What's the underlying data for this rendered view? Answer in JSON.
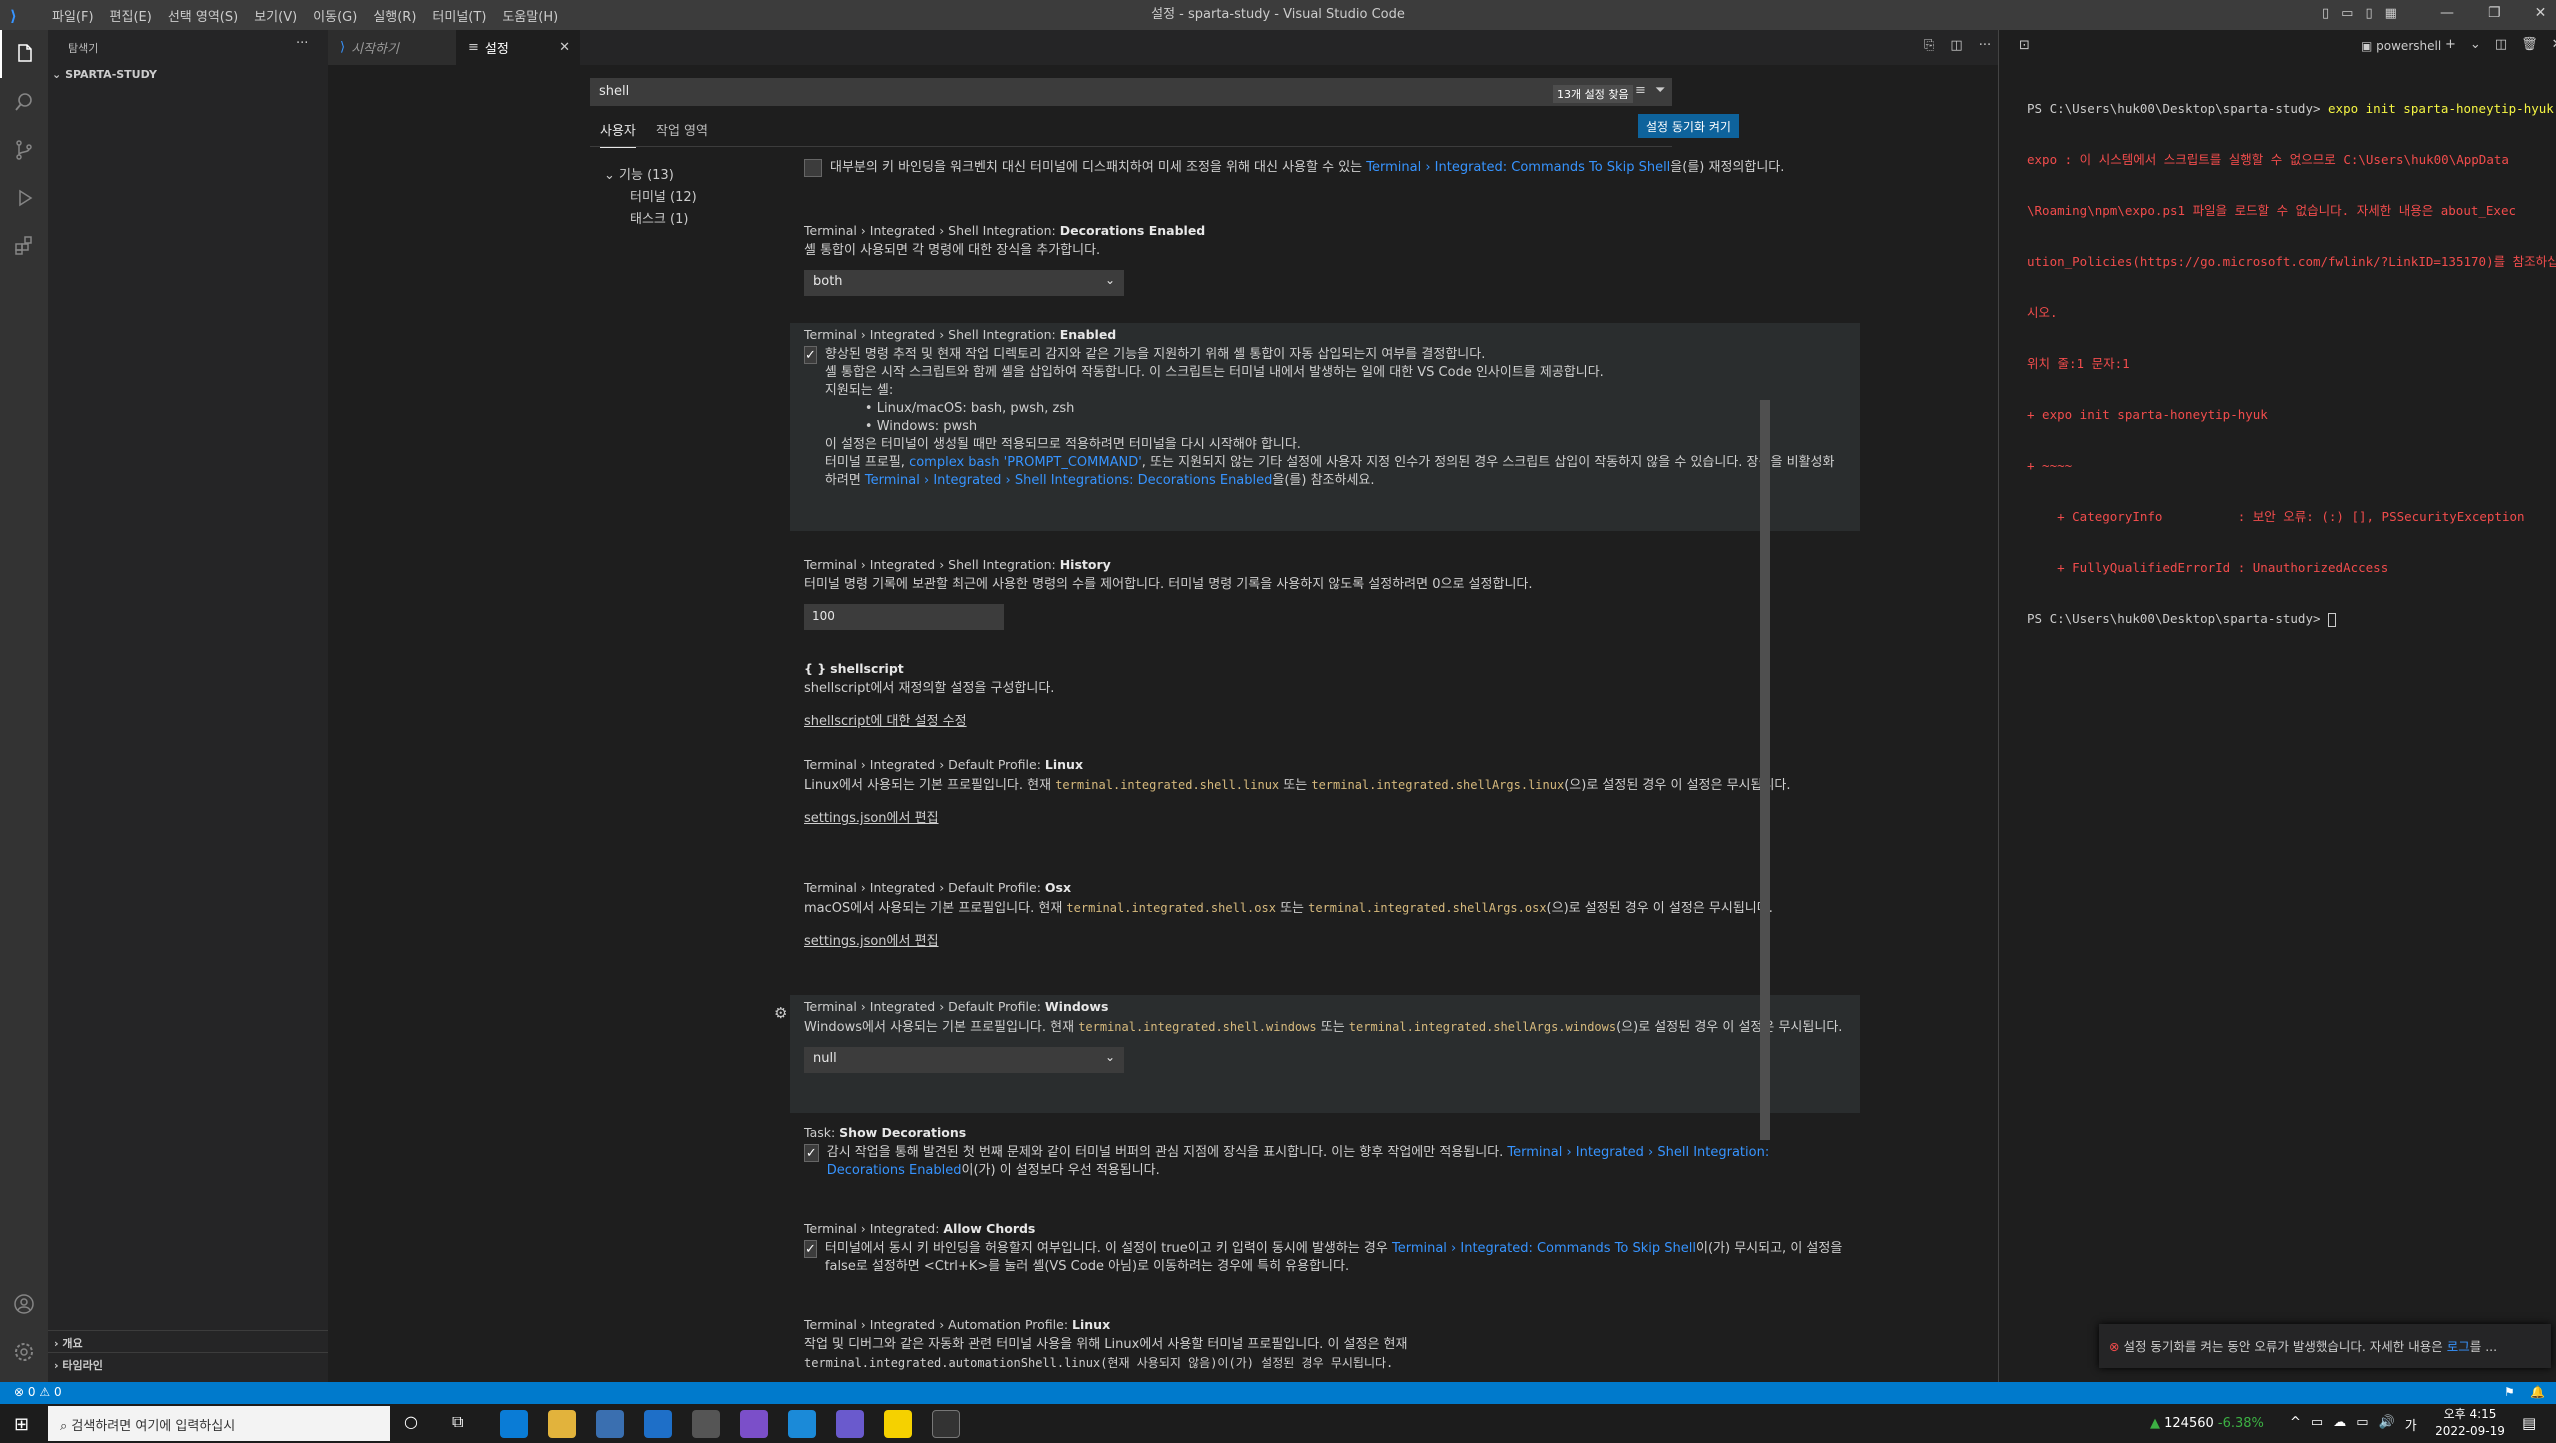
{
  "window": {
    "title": "설정 - sparta-study - Visual Studio Code"
  },
  "menu": [
    "파일(F)",
    "편집(E)",
    "선택 영역(S)",
    "보기(V)",
    "이동(G)",
    "실행(R)",
    "터미널(T)",
    "도움말(H)"
  ],
  "sidebar": {
    "title": "탐색기",
    "folder": "SPARTA-STUDY",
    "outline": "개요",
    "timeline": "타임라인"
  },
  "tabs": [
    {
      "label": "시작하기"
    },
    {
      "label": "설정"
    }
  ],
  "settings": {
    "search_value": "shell",
    "result_count": "13개 설정 찾음",
    "scope_user": "사용자",
    "scope_workspace": "작업 영역",
    "sync_button": "설정 동기화 켜기",
    "toc": {
      "group": "기능 (13)",
      "terminal": "터미널 (12)",
      "task": "태스크 (1)"
    },
    "items": {
      "skip_desc": "대부분의 키 바인딩을 워크벤치 대신 터미널에 디스패치하여 미세 조정을 위해 대신 사용할 수 있는 ",
      "skip_link": "Terminal › Integrated: Commands To Skip Shell",
      "skip_tail": "을(를) 재정의합니다.",
      "deco_cat": "Terminal › Integrated › Shell Integration: ",
      "deco_name": "Decorations Enabled",
      "deco_desc": "셸 통합이 사용되면 각 명령에 대한 장식을 추가합니다.",
      "deco_value": "both",
      "en_cat": "Terminal › Integrated › Shell Integration: ",
      "en_name": "Enabled",
      "en_l1": "향상된 명령 추적 및 현재 작업 디렉토리 감지와 같은 기능을 지원하기 위해 셸 통합이 자동 삽입되는지 여부를 결정합니다.",
      "en_l2": "셸 통합은 시작 스크립트와 함께 셸을 삽입하여 작동합니다. 이 스크립트는 터미널 내에서 발생하는 일에 대한 VS Code 인사이트를 제공합니다.",
      "en_l3": "지원되는 셸:",
      "en_b1": "Linux/macOS: bash, pwsh, zsh",
      "en_b2": "Windows: pwsh",
      "en_l4": "이 설정은 터미널이 생성될 때만 적용되므로 적용하려면 터미널을 다시 시작해야 합니다.",
      "en_l5a": "터미널 프로필, ",
      "en_l5link": "complex bash 'PROMPT_COMMAND'",
      "en_l5b": ", 또는 지원되지 않는 기타 설정에 사용자 지정 인수가 정의된 경우 스크립트 삽입이 작동하지 않을 수 있습니다. 장식을 비활성화하려면 ",
      "en_l5link2": "Terminal › Integrated › Shell Integrations: Decorations Enabled",
      "en_l5c": "을(를) 참조하세요.",
      "hist_cat": "Terminal › Integrated › Shell Integration: ",
      "hist_name": "History",
      "hist_desc": "터미널 명령 기록에 보관할 최근에 사용한 명령의 수를 제어합니다. 터미널 명령 기록을 사용하지 않도록 설정하려면 0으로 설정합니다.",
      "hist_value": "100",
      "ss_braces": "{ }",
      "ss_name": "shellscript",
      "ss_desc": "shellscript에서 재정의할 설정을 구성합니다.",
      "ss_link": "shellscript에 대한 설정 수정",
      "lin_cat": "Terminal › Integrated › Default Profile: ",
      "lin_name": "Linux",
      "lin_a": "Linux에서 사용되는 기본 프로필입니다. 현재 ",
      "lin_c1": "terminal.integrated.shell.linux",
      "lin_b": " 또는 ",
      "lin_c2": "terminal.integrated.shellArgs.linux",
      "lin_d": "(으)로 설정된 경우 이 설정은 무시됩니다.",
      "json_link": "settings.json에서 편집",
      "osx_cat": "Terminal › Integrated › Default Profile: ",
      "osx_name": "Osx",
      "osx_a": "macOS에서 사용되는 기본 프로필입니다. 현재 ",
      "osx_c1": "terminal.integrated.shell.osx",
      "osx_b": " 또는 ",
      "osx_c2": "terminal.integrated.shellArgs.osx",
      "osx_d": "(으)로 설정된 경우 이 설정은 무시됩니다.",
      "win_cat": "Terminal › Integrated › Default Profile: ",
      "win_name": "Windows",
      "win_a": "Windows에서 사용되는 기본 프로필입니다. 현재 ",
      "win_c1": "terminal.integrated.shell.windows",
      "win_b": " 또는 ",
      "win_c2": "terminal.integrated.shellArgs.windows",
      "win_d": "(으)로 설정된 경우 이 설정은 무시됩니다.",
      "win_value": "null",
      "task_cat": "Task: ",
      "task_name": "Show Decorations",
      "task_a": "감시 작업을 통해 발견된 첫 번째 문제와 같이 터미널 버퍼의 관심 지점에 장식을 표시합니다. 이는 향후 작업에만 적용됩니다. ",
      "task_link": "Terminal › Integrated › Shell Integration: Decorations Enabled",
      "task_b": "이(가) 이 설정보다 우선 적용됩니다.",
      "ch_cat": "Terminal › Integrated: ",
      "ch_name": "Allow Chords",
      "ch_a": "터미널에서 동시 키 바인딩을 허용할지 여부입니다. 이 설정이 true이고 키 입력이 동시에 발생하는 경우 ",
      "ch_link": "Terminal › Integrated: Commands To Skip Shell",
      "ch_b": "이(가) 무시되고, 이 설정을 false로 설정하면 <Ctrl+K>를 눌러 셸(VS Code 아님)로 이동하려는 경우에 특히 유용합니다.",
      "ap_cat": "Terminal › Integrated › Automation Profile: ",
      "ap_name": "Linux",
      "ap_a": "작업 및 디버그와 같은 자동화 관련 터미널 사용을 위해 Linux에서 사용할 터미널 프로필입니다. 이 설정은 현재 ",
      "ap_b": "terminal.integrated.automationShell.linux(현재 사용되지 않음)이(가) 설정된 경우 무시됩니다."
    }
  },
  "terminal": {
    "shell": "powershell",
    "lines": [
      {
        "t": "PS C:\\Users\\huk00\\Desktop\\sparta-study> ",
        "cmd": "expo init sparta-honeytip-hyuk"
      },
      {
        "e": "expo : 이 시스템에서 스크립트를 실행할 수 없으므로 C:\\Users\\huk00\\AppData"
      },
      {
        "e": "\\Roaming\\npm\\expo.ps1 파일을 로드할 수 없습니다. 자세한 내용은 about_Exec"
      },
      {
        "e": "ution_Policies(https://go.microsoft.com/fwlink/?LinkID=135170)를 참조하십"
      },
      {
        "e": "시오."
      },
      {
        "e": "위치 줄:1 문자:1"
      },
      {
        "e": "+ expo init sparta-honeytip-hyuk"
      },
      {
        "e": "+ ~~~~"
      },
      {
        "e": "    + CategoryInfo          : 보안 오류: (:) [], PSSecurityException"
      },
      {
        "e": "    + FullyQualifiedErrorId : UnauthorizedAccess"
      },
      {
        "t": "PS C:\\Users\\huk00\\Desktop\\sparta-study> ",
        "cmd": ""
      }
    ]
  },
  "notification": {
    "text": "설정 동기화를 켜는 동안 오류가 발생했습니다. 자세한 내용은 ",
    "link": "로그",
    "tail": "를 ..."
  },
  "status": {
    "problems": "0",
    "warnings": "0"
  },
  "taskbar": {
    "search": "검색하려면 여기에 입력하십시",
    "stock": "124560",
    "stock_change": "-6.38%",
    "time": "오후 4:15",
    "date": "2022-09-19",
    "lang": "가"
  },
  "colors": {
    "accent": "#007acc",
    "error": "#f14c4c",
    "link": "#3794ff"
  }
}
